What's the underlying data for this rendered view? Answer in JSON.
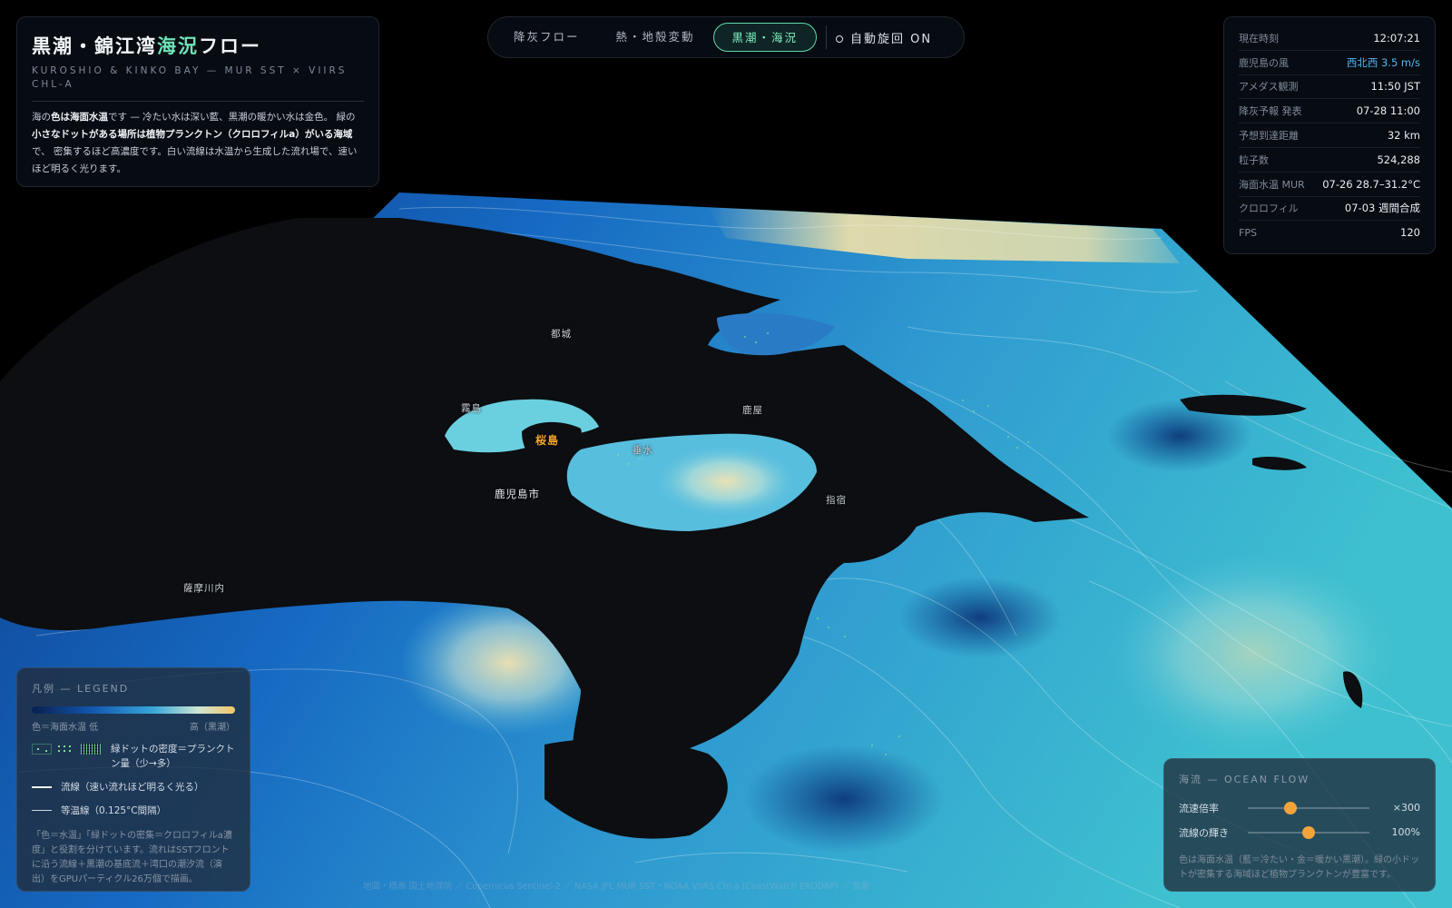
{
  "header": {
    "title_pre": "黒潮・錦江湾",
    "title_highlight": "海況",
    "title_post": "フロー",
    "subtitle": "KUROSHIO & KINKO BAY — MUR SST × VIIRS CHL-A",
    "desc_p1": "海の",
    "desc_b1": "色は海面水温",
    "desc_p2": "です — 冷たい水は深い藍、黒潮の暖かい水は金色。 緑の",
    "desc_b2": "小さなドットがある場所は植物プランクトン（クロロフィルa）がいる海域",
    "desc_p3": "で、 密集するほど高濃度です。白い流線は水温から生成した流れ場で、速いほど明るく光ります。"
  },
  "nav": {
    "tabs": [
      {
        "label": "降灰フロー"
      },
      {
        "label": "熱・地殻変動"
      },
      {
        "label": "黒潮・海況"
      }
    ],
    "rotate_label": "自動旋回 ON"
  },
  "stats": [
    {
      "label": "現在時刻",
      "value": "12:07:21"
    },
    {
      "label": "鹿児島の風",
      "value": "西北西 3.5 m/s"
    },
    {
      "label": "アメダス観測",
      "value": "11:50 JST"
    },
    {
      "label": "降灰予報 発表",
      "value": "07-28 11:00"
    },
    {
      "label": "予想到達距離",
      "value": "32 km"
    },
    {
      "label": "粒子数",
      "value": "524,288"
    },
    {
      "label": "海面水温 MUR",
      "value": "07-26 28.7–31.2°C"
    },
    {
      "label": "クロロフィル",
      "value": "07-03 週間合成"
    },
    {
      "label": "FPS",
      "value": "120"
    }
  ],
  "colors": {
    "wind_value": "#4fb6f0",
    "accent": "#6fe3b8",
    "knob": "#f2a33a"
  },
  "legend": {
    "title": "凡例 — LEGEND",
    "grad_low": "色＝海面水温 低",
    "grad_high": "高（黒潮）",
    "dots_label": "緑ドットの密度＝プランクトン量（少→多）",
    "streamline_label": "流線（速い流れほど明るく光る）",
    "isotherm_label": "等温線（0.125°C間隔）",
    "note": "「色＝水温」「緑ドットの密集＝クロロフィルa濃度」と役割を分けています。流れはSSTフロントに沿う流線＋黒潮の基底流＋湾口の潮汐流（演出）をGPUパーティクル26万個で描画。"
  },
  "flow": {
    "title": "海流 — OCEAN FLOW",
    "speed_label": "流速倍率",
    "speed_value": "×300",
    "speed_level": 0.35,
    "glow_label": "流線の輝き",
    "glow_value": "100%",
    "glow_level": 0.5,
    "note": "色は海面水温（藍＝冷たい・金＝暖かい黒潮）。緑の小ドットが密集する海域ほど植物プランクトンが豊富です。"
  },
  "map_labels": {
    "miyakonojo": "都城",
    "kirishima": "霧島",
    "kanoya": "鹿屋",
    "sakurajima": "桜島",
    "tarumizu": "垂水",
    "kagoshima": "鹿児島市",
    "ibusuki": "指宿",
    "satsumasendai": "薩摩川内"
  },
  "credit": "地図・標高 国土地理院 ／ Copernicus Sentinel-2 ／ NASA JPL MUR SST・NOAA VIIRS Chl-a (CoastWatch ERDDAP) ／ 気象"
}
